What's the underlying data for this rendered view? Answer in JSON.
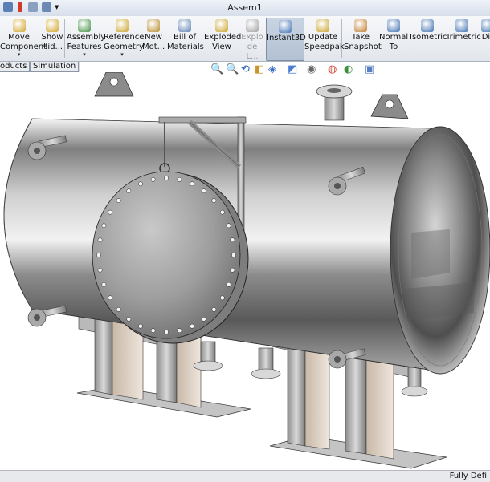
{
  "window": {
    "title": "Assem1"
  },
  "ribbon": {
    "buttons": [
      {
        "id": "move-component",
        "line1": "Move",
        "line2": "Component",
        "icon": "move-component-icon",
        "state": "normal",
        "has_dropdown": true
      },
      {
        "id": "show-hidden",
        "line1": "Show",
        "line2": "Hid...",
        "icon": "show-hidden-icon",
        "state": "normal",
        "has_dropdown": false
      },
      {
        "id": "assembly-features",
        "line1": "Assembly",
        "line2": "Features",
        "icon": "assembly-features-icon",
        "state": "normal",
        "has_dropdown": true
      },
      {
        "id": "reference-geometry",
        "line1": "Reference",
        "line2": "Geometry",
        "icon": "reference-geometry-icon",
        "state": "normal",
        "has_dropdown": true
      },
      {
        "id": "new-motion-study",
        "line1": "New",
        "line2": "Mot...",
        "icon": "new-motion-icon",
        "state": "normal",
        "has_dropdown": false
      },
      {
        "id": "bill-of-materials",
        "line1": "Bill of",
        "line2": "Materials",
        "icon": "bill-of-materials-icon",
        "state": "normal",
        "has_dropdown": false
      },
      {
        "id": "exploded-view",
        "line1": "Exploded",
        "line2": "View",
        "icon": "exploded-view-icon",
        "state": "normal",
        "has_dropdown": false
      },
      {
        "id": "explode-line-sketch",
        "line1": "Explo",
        "line2": "de L...",
        "icon": "explode-line-icon",
        "state": "disabled",
        "has_dropdown": false
      },
      {
        "id": "instant3d",
        "line1": "Instant3D",
        "line2": "",
        "icon": "instant3d-icon",
        "state": "active",
        "has_dropdown": false
      },
      {
        "id": "update-speedpak",
        "line1": "Update",
        "line2": "Speedpak",
        "icon": "update-speedpak-icon",
        "state": "normal",
        "has_dropdown": false
      },
      {
        "id": "take-snapshot",
        "line1": "Take",
        "line2": "Snapshot",
        "icon": "take-snapshot-icon",
        "state": "normal",
        "has_dropdown": false
      },
      {
        "id": "normal-to",
        "line1": "Normal",
        "line2": "To",
        "icon": "normal-to-icon",
        "state": "normal",
        "has_dropdown": false
      },
      {
        "id": "isometric",
        "line1": "Isometric",
        "line2": "",
        "icon": "isometric-icon",
        "state": "normal",
        "has_dropdown": false
      },
      {
        "id": "trimetric",
        "line1": "Trimetric",
        "line2": "",
        "icon": "trimetric-icon",
        "state": "normal",
        "has_dropdown": false
      },
      {
        "id": "dimetric",
        "line1": "Dir",
        "line2": "",
        "icon": "dimetric-icon",
        "state": "normal",
        "has_dropdown": false
      }
    ]
  },
  "tabs": [
    {
      "label": "oducts",
      "active": false
    },
    {
      "label": "Simulation",
      "active": false
    }
  ],
  "heads_up_toolbar": {
    "icons": [
      "zoom-to-fit-icon",
      "zoom-to-area-icon",
      "previous-view-icon",
      "section-view-icon",
      "view-orientation-icon",
      "display-style-icon",
      "hide-show-items-icon",
      "edit-appearance-icon",
      "apply-scene-icon",
      "view-settings-icon"
    ]
  },
  "status": {
    "text": "Fully Defi"
  },
  "colors": {
    "accent": "#3c6fb0",
    "ribbon_bg": "#eceff3",
    "viewport_bg": "#ffffff",
    "steel": "#9aa0a6"
  }
}
